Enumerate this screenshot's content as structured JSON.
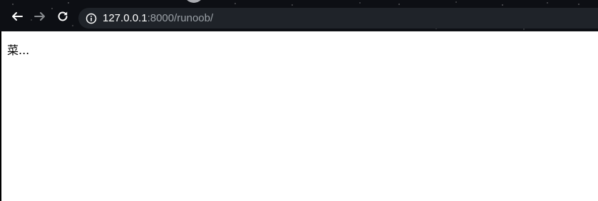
{
  "browser": {
    "toolbar": {
      "back_icon": "arrow-left-icon",
      "forward_icon": "arrow-right-icon",
      "reload_icon": "reload-icon",
      "site_info_icon": "info-icon"
    },
    "address_bar": {
      "host": "127.0.0.1",
      "rest": ":8000/runoob/"
    },
    "colors": {
      "toolbar_bg": "#0d0f14",
      "omnibox_bg": "#1f2329",
      "url_host": "#ffffff",
      "url_rest": "#9aa0a6"
    }
  },
  "page": {
    "text": "菜..."
  }
}
